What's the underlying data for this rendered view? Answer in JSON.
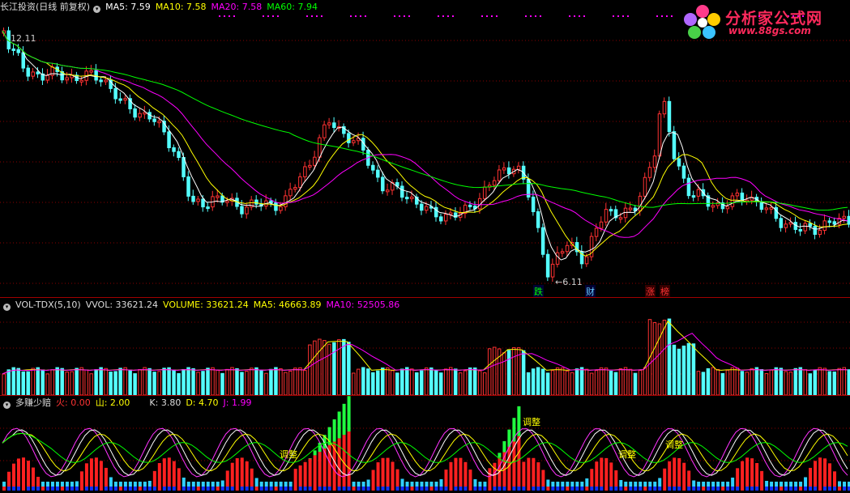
{
  "main_panel": {
    "stock_title": "长江投资(日线 前复权)",
    "ma5_label": "MA5: 7.59",
    "ma10_label": "MA10: 7.58",
    "ma20_label": "MA20: 7.58",
    "ma60_label": "MA60: 7.94",
    "high_label": "12.11",
    "low_label": "←6.11",
    "markers": [
      "跌",
      "财",
      "涨",
      "榜"
    ]
  },
  "volume_panel": {
    "indicator": "VOL-TDX(5,10)",
    "vvol": "VVOL: 33621.24",
    "volume": "VOLUME: 33621.24",
    "ma5": "MA5: 46663.89",
    "ma10": "MA10: 52505.86"
  },
  "kdj_panel": {
    "indicator": "多赚少赔",
    "fire": "火: 0.00",
    "mountain": "山: 2.00",
    "k": "K: 3.80",
    "d": "D: 4.70",
    "j": "J: 1.99",
    "adjust_labels": [
      "调整",
      "调整",
      "调整",
      "调整"
    ]
  },
  "logo": {
    "name": "分析家公式网",
    "url": "www.88gs.com"
  },
  "colors": {
    "background": "#000000",
    "up": "#ff3232",
    "down": "#54ffff",
    "ma5": "#ffffff",
    "ma10": "#ffff00",
    "ma20": "#ff00ff",
    "ma60": "#00ff00",
    "separator": "#a00000"
  }
}
